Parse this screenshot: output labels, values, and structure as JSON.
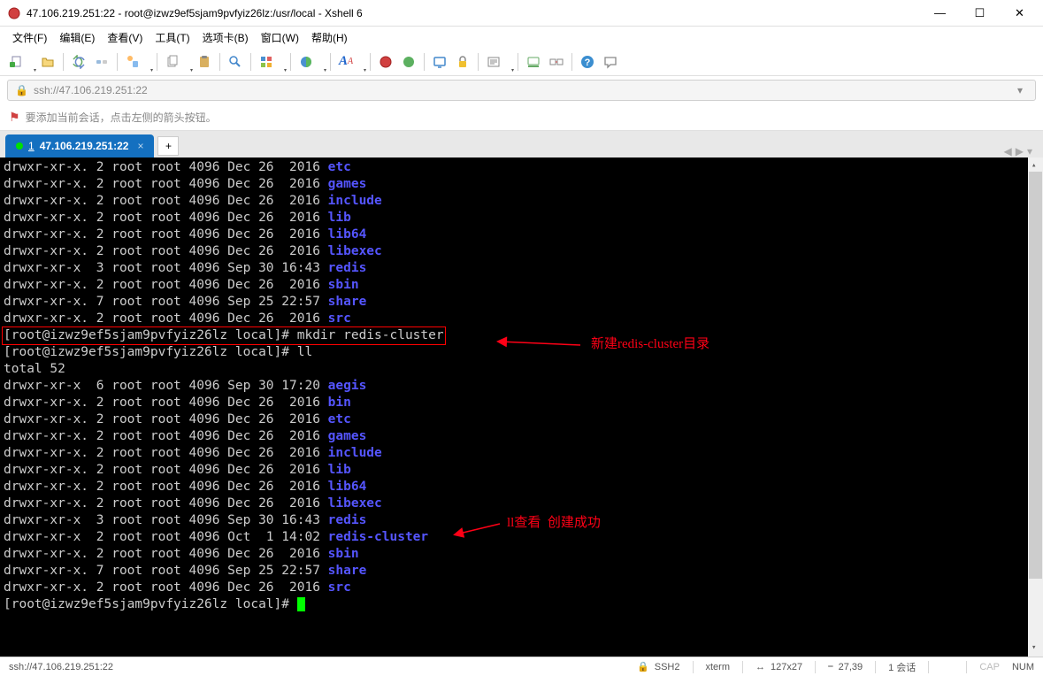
{
  "window": {
    "title": "47.106.219.251:22 - root@izwz9ef5sjam9pvfyiz26lz:/usr/local - Xshell 6"
  },
  "menu": {
    "file": "文件(F)",
    "edit": "编辑(E)",
    "view": "查看(V)",
    "tools": "工具(T)",
    "tabs": "选项卡(B)",
    "window": "窗口(W)",
    "help": "帮助(H)"
  },
  "address": {
    "text": "ssh://47.106.219.251:22"
  },
  "hint": {
    "text": "要添加当前会话，点击左侧的箭头按钮。"
  },
  "tabs": {
    "active_num": "1",
    "active_label": "47.106.219.251:22",
    "add": "+"
  },
  "terminal": {
    "ls1": [
      {
        "perm": "drwxr-xr-x.",
        "n": "2",
        "o": "root",
        "g": "root",
        "size": "4096",
        "date": "Dec 26  2016",
        "name": "etc"
      },
      {
        "perm": "drwxr-xr-x.",
        "n": "2",
        "o": "root",
        "g": "root",
        "size": "4096",
        "date": "Dec 26  2016",
        "name": "games"
      },
      {
        "perm": "drwxr-xr-x.",
        "n": "2",
        "o": "root",
        "g": "root",
        "size": "4096",
        "date": "Dec 26  2016",
        "name": "include"
      },
      {
        "perm": "drwxr-xr-x.",
        "n": "2",
        "o": "root",
        "g": "root",
        "size": "4096",
        "date": "Dec 26  2016",
        "name": "lib"
      },
      {
        "perm": "drwxr-xr-x.",
        "n": "2",
        "o": "root",
        "g": "root",
        "size": "4096",
        "date": "Dec 26  2016",
        "name": "lib64"
      },
      {
        "perm": "drwxr-xr-x.",
        "n": "2",
        "o": "root",
        "g": "root",
        "size": "4096",
        "date": "Dec 26  2016",
        "name": "libexec"
      },
      {
        "perm": "drwxr-xr-x ",
        "n": "3",
        "o": "root",
        "g": "root",
        "size": "4096",
        "date": "Sep 30 16:43",
        "name": "redis"
      },
      {
        "perm": "drwxr-xr-x.",
        "n": "2",
        "o": "root",
        "g": "root",
        "size": "4096",
        "date": "Dec 26  2016",
        "name": "sbin"
      },
      {
        "perm": "drwxr-xr-x.",
        "n": "7",
        "o": "root",
        "g": "root",
        "size": "4096",
        "date": "Sep 25 22:57",
        "name": "share"
      },
      {
        "perm": "drwxr-xr-x.",
        "n": "2",
        "o": "root",
        "g": "root",
        "size": "4096",
        "date": "Dec 26  2016",
        "name": "src"
      }
    ],
    "prompt": "[root@izwz9ef5sjam9pvfyiz26lz local]# ",
    "cmd_mkdir": "mkdir redis-cluster",
    "cmd_ll": "ll",
    "total": "total 52",
    "ls2": [
      {
        "perm": "drwxr-xr-x ",
        "n": "6",
        "o": "root",
        "g": "root",
        "size": "4096",
        "date": "Sep 30 17:20",
        "name": "aegis"
      },
      {
        "perm": "drwxr-xr-x.",
        "n": "2",
        "o": "root",
        "g": "root",
        "size": "4096",
        "date": "Dec 26  2016",
        "name": "bin"
      },
      {
        "perm": "drwxr-xr-x.",
        "n": "2",
        "o": "root",
        "g": "root",
        "size": "4096",
        "date": "Dec 26  2016",
        "name": "etc"
      },
      {
        "perm": "drwxr-xr-x.",
        "n": "2",
        "o": "root",
        "g": "root",
        "size": "4096",
        "date": "Dec 26  2016",
        "name": "games"
      },
      {
        "perm": "drwxr-xr-x.",
        "n": "2",
        "o": "root",
        "g": "root",
        "size": "4096",
        "date": "Dec 26  2016",
        "name": "include"
      },
      {
        "perm": "drwxr-xr-x.",
        "n": "2",
        "o": "root",
        "g": "root",
        "size": "4096",
        "date": "Dec 26  2016",
        "name": "lib"
      },
      {
        "perm": "drwxr-xr-x.",
        "n": "2",
        "o": "root",
        "g": "root",
        "size": "4096",
        "date": "Dec 26  2016",
        "name": "lib64"
      },
      {
        "perm": "drwxr-xr-x.",
        "n": "2",
        "o": "root",
        "g": "root",
        "size": "4096",
        "date": "Dec 26  2016",
        "name": "libexec"
      },
      {
        "perm": "drwxr-xr-x ",
        "n": "3",
        "o": "root",
        "g": "root",
        "size": "4096",
        "date": "Sep 30 16:43",
        "name": "redis"
      },
      {
        "perm": "drwxr-xr-x ",
        "n": "2",
        "o": "root",
        "g": "root",
        "size": "4096",
        "date": "Oct  1 14:02",
        "name": "redis-cluster"
      },
      {
        "perm": "drwxr-xr-x.",
        "n": "2",
        "o": "root",
        "g": "root",
        "size": "4096",
        "date": "Dec 26  2016",
        "name": "sbin"
      },
      {
        "perm": "drwxr-xr-x.",
        "n": "7",
        "o": "root",
        "g": "root",
        "size": "4096",
        "date": "Sep 25 22:57",
        "name": "share"
      },
      {
        "perm": "drwxr-xr-x.",
        "n": "2",
        "o": "root",
        "g": "root",
        "size": "4096",
        "date": "Dec 26  2016",
        "name": "src"
      }
    ]
  },
  "annotations": {
    "anno1": "新建redis-cluster目录",
    "anno2": "ll查看  创建成功"
  },
  "status": {
    "left": "ssh://47.106.219.251:22",
    "ssh": "SSH2",
    "term": "xterm",
    "size": "127x27",
    "pos": "27,39",
    "sess": "1 会话",
    "cap": "CAP",
    "num": "NUM"
  }
}
